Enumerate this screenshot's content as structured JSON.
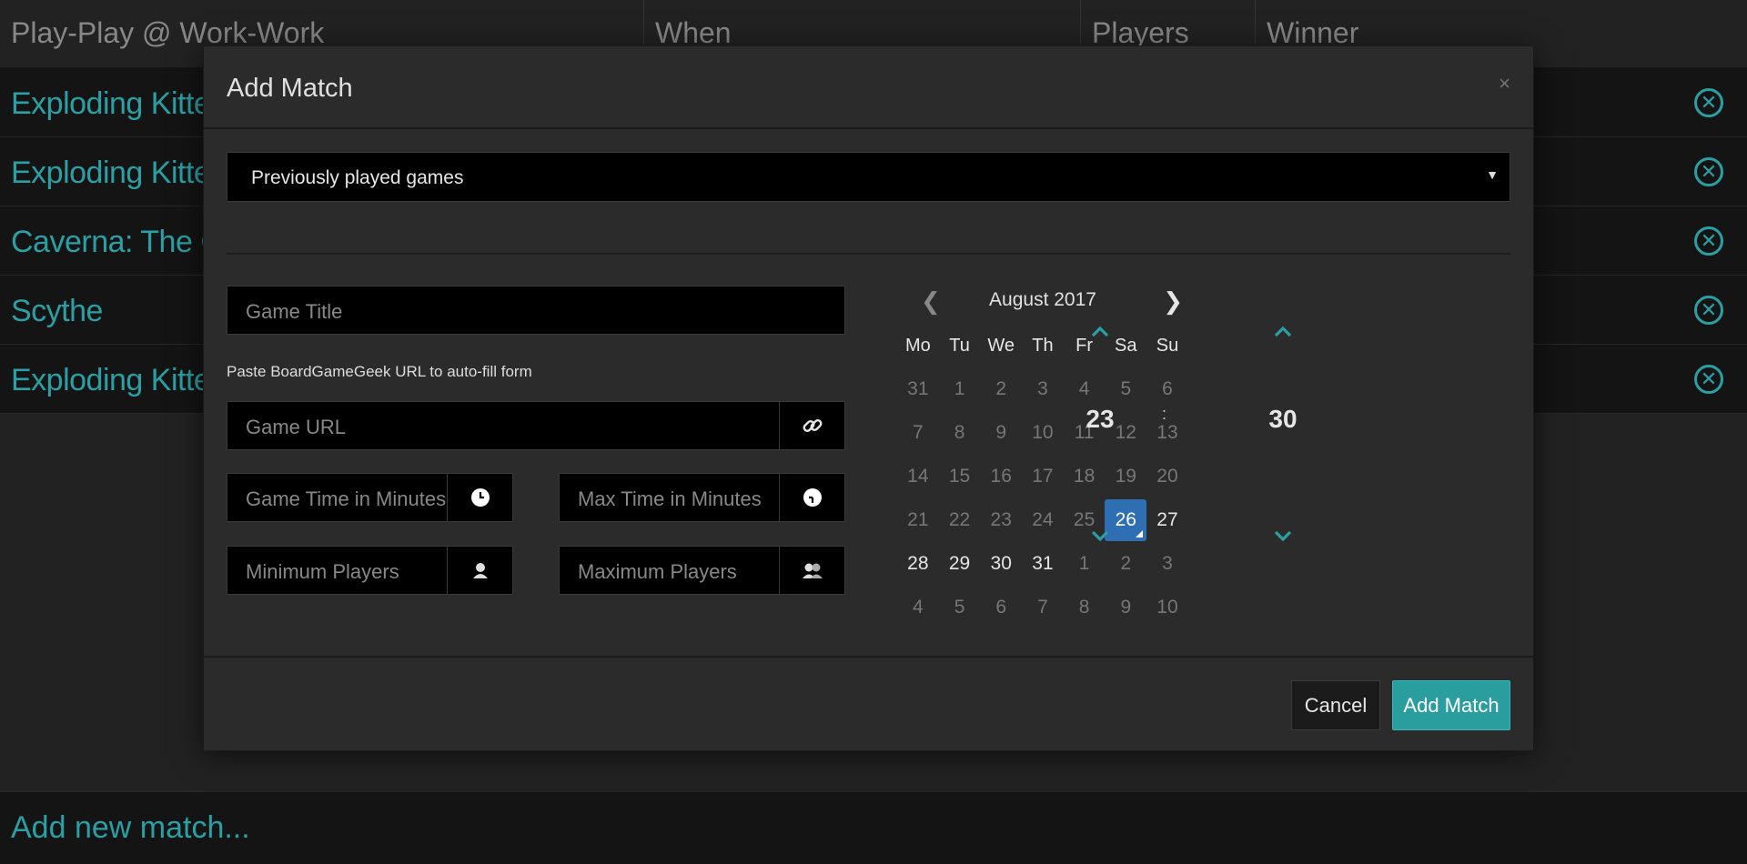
{
  "table": {
    "headers": [
      "Play-Play @ Work-Work",
      "When",
      "Players",
      "Winner"
    ],
    "rows": [
      {
        "game": "Exploding Kittens"
      },
      {
        "game": "Exploding Kittens"
      },
      {
        "game": "Caverna: The Cave"
      },
      {
        "game": "Scythe"
      },
      {
        "game": "Exploding Kittens"
      }
    ],
    "delete_glyph": "✕",
    "add_link": "Add new match..."
  },
  "modal": {
    "title": "Add Match",
    "close_glyph": "×",
    "game_select": {
      "value": "Previously played games",
      "caret": "▼"
    },
    "game_title": {
      "placeholder": "Game Title"
    },
    "url_hint": "Paste BoardGameGeek URL to auto-fill form",
    "game_url": {
      "placeholder": "Game URL",
      "icon": "link-icon"
    },
    "game_time": {
      "placeholder": "Game Time in Minutes",
      "icon": "clock-icon"
    },
    "max_time": {
      "placeholder": "Max Time in Minutes",
      "icon": "clock-icon"
    },
    "min_players": {
      "placeholder": "Minimum Players",
      "icon": "user-icon"
    },
    "max_players": {
      "placeholder": "Maximum Players",
      "icon": "users-icon"
    },
    "calendar": {
      "month": "August 2017",
      "prev": "❮",
      "next": "❯",
      "weekdays": [
        "Mo",
        "Tu",
        "We",
        "Th",
        "Fr",
        "Sa",
        "Su"
      ],
      "weeks": [
        [
          "31",
          "1",
          "2",
          "3",
          "4",
          "5",
          "6"
        ],
        [
          "7",
          "8",
          "9",
          "10",
          "11",
          "12",
          "13"
        ],
        [
          "14",
          "15",
          "16",
          "17",
          "18",
          "19",
          "20"
        ],
        [
          "21",
          "22",
          "23",
          "24",
          "25",
          "26",
          "27"
        ],
        [
          "28",
          "29",
          "30",
          "31",
          "1",
          "2",
          "3"
        ],
        [
          "4",
          "5",
          "6",
          "7",
          "8",
          "9",
          "10"
        ]
      ],
      "selected": "26"
    },
    "time": {
      "hours": "23",
      "separator": ":",
      "minutes": "30",
      "up": "⌃",
      "down": "⌄"
    },
    "cancel_label": "Cancel",
    "submit_label": "Add Match"
  },
  "colors": {
    "accent": "#2aa0a4",
    "selected_day": "#2e6fb3",
    "background": "#222222"
  }
}
